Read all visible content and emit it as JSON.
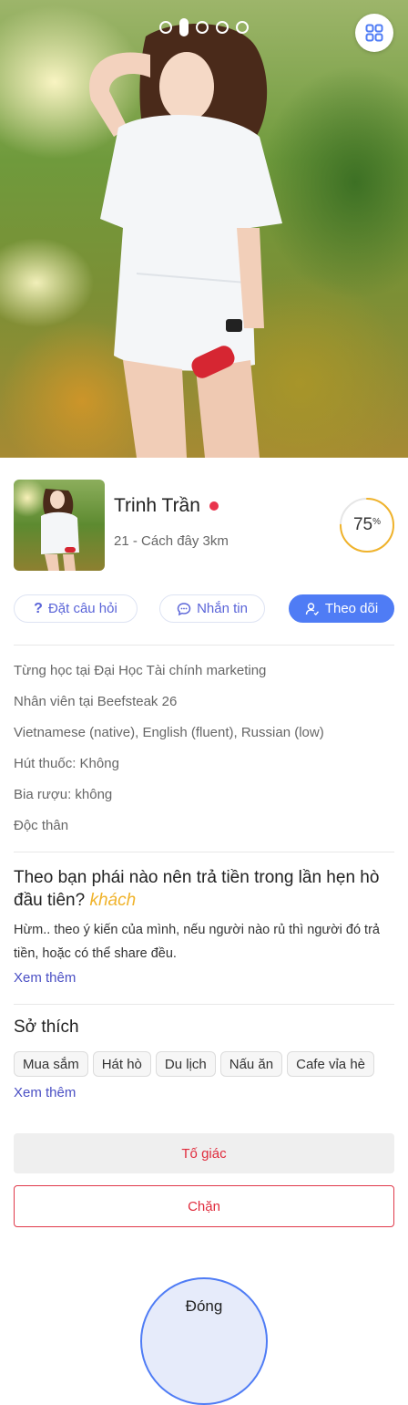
{
  "carousel": {
    "count": 5,
    "active_index": 1
  },
  "profile": {
    "name": "Trinh Trần",
    "subline": "21 - Cách đây 3km",
    "online": true,
    "match_percent": 75,
    "match_value_label": "75",
    "match_unit": "%"
  },
  "actions": {
    "ask_label": "Đặt câu hỏi",
    "message_label": "Nhắn tin",
    "follow_label": "Theo dõi"
  },
  "info": [
    "Từng học tại Đại Học Tài chính marketing",
    "Nhân viên tại Beefsteak 26",
    "Vietnamese (native), English (fluent), Russian (low)",
    "Hút thuốc: Không",
    "Bia rượu: không",
    "Độc thân"
  ],
  "question": {
    "title": "Theo bạn phái nào nên trả tiền trong lần hẹn hò đầu tiên?",
    "answer": "khách",
    "body": "Hừm.. theo ý kiến của mình, nếu người nào rủ thì người đó trả tiền, hoặc có thể share đều.",
    "more_label": "Xem thêm"
  },
  "hobbies": {
    "title": "Sở thích",
    "tags": [
      "Mua sắm",
      "Hát hò",
      "Du lịch",
      "Nấu ăn",
      "Cafe vỉa hè"
    ],
    "more_label": "Xem thêm"
  },
  "buttons": {
    "report_label": "Tố giác",
    "block_label": "Chặn",
    "close_label": "Đóng"
  },
  "colors": {
    "accent": "#4f7cf5",
    "link": "#4a4fc4",
    "danger": "#e02b3c",
    "online": "#e9344d",
    "answer": "#f0b32b",
    "match_ring": "#f0b32b"
  }
}
